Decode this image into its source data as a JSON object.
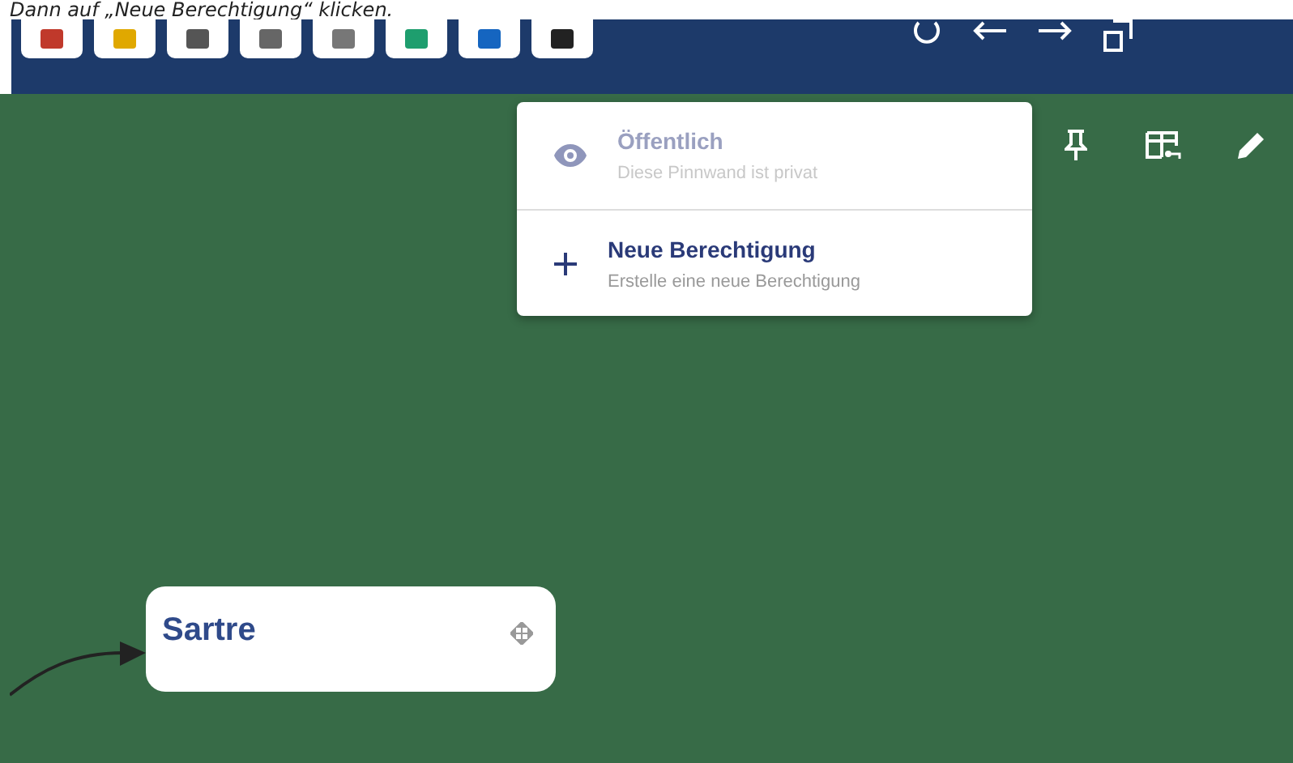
{
  "caption": "Dann auf „Neue Berechtigung“ klicken.",
  "menu": {
    "items": [
      {
        "kind": "visibility",
        "title": "Öffentlich",
        "subtitle": "Diese Pinnwand ist privat",
        "disabled": true
      },
      {
        "kind": "add",
        "title": "Neue Berechtigung",
        "subtitle": "Erstelle eine neue Berechtigung",
        "disabled": false
      }
    ]
  },
  "node": {
    "title": "Sartre"
  }
}
